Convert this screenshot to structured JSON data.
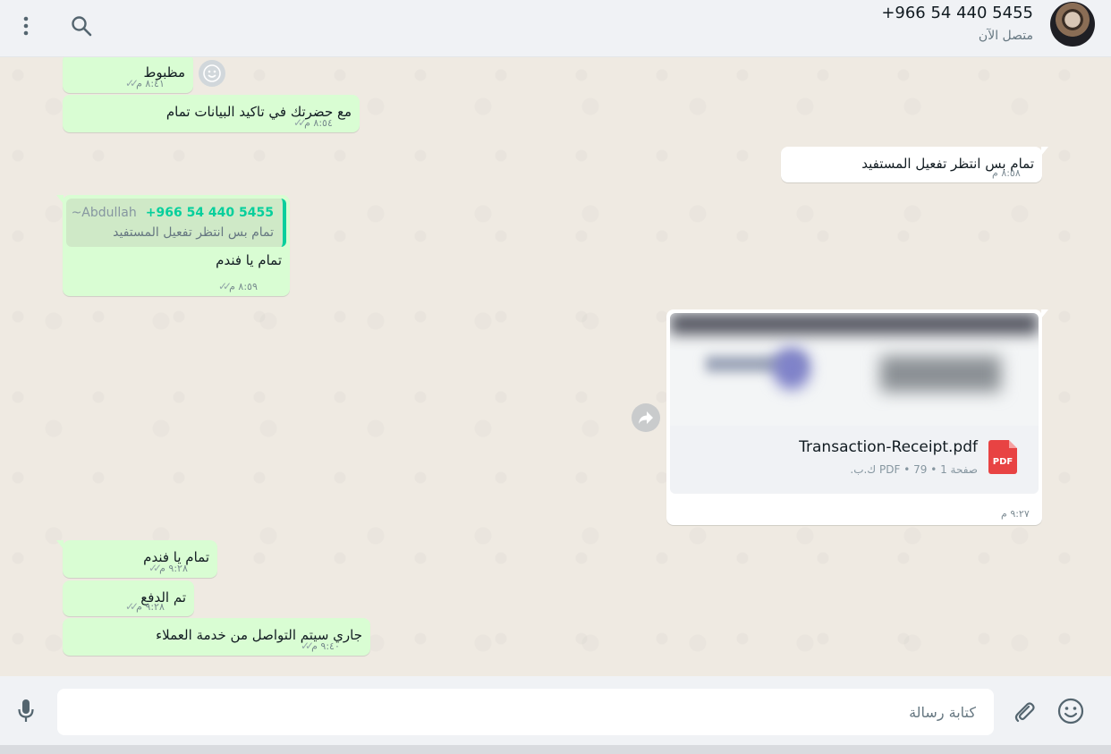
{
  "header": {
    "contact_name": "+966 54 440 5455",
    "contact_status": "متصل الآن",
    "menu_icon": "kebab-menu-icon",
    "search_icon": "search-icon"
  },
  "messages": {
    "m1": {
      "text": "مظبوط",
      "time": "٨:٤١ م"
    },
    "m2": {
      "text": "مع حضرتك في تاكيد البيانات تمام",
      "time": "٨:٥٤ م"
    },
    "m3": {
      "text": "تمام بس انتظر تفعيل المستفيد",
      "time": "٨:٥٨ م"
    },
    "m4": {
      "quote_number": "+966 54 440 5455",
      "quote_alias": "~Abdullah",
      "quote_text": "تمام بس انتظر تفعيل المستفيد",
      "text": "تمام يا فندم",
      "time": "٨:٥٩ م"
    },
    "doc": {
      "file_name": "Transaction-Receipt.pdf",
      "file_info": "صفحة 1 • PDF • 79 ك.ب.",
      "file_badge": "PDF",
      "time": "٩:٢٧ م"
    },
    "m5": {
      "text": "تمام يا فندم",
      "time": "٩:٢٨ م"
    },
    "m6": {
      "text": "تم الدفع",
      "time": "٩:٢٨ م"
    },
    "m7": {
      "text": "جاري سيتم التواصل من خدمة العملاء",
      "time": "٩:٤٠ م"
    }
  },
  "composer": {
    "placeholder": "كتابة رسالة"
  },
  "colors": {
    "outgoing_bubble": "#d9fdd3",
    "incoming_bubble": "#ffffff",
    "chat_background": "#efeae2",
    "accent_green": "#06cf9c",
    "pdf_red": "#e84343"
  }
}
